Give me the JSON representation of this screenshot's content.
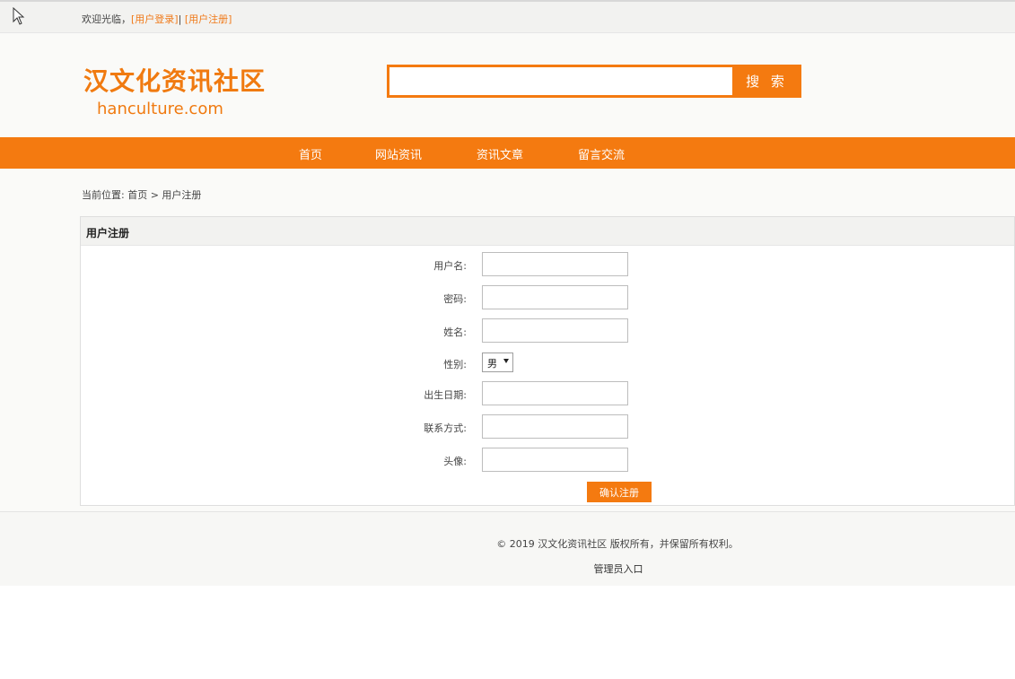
{
  "topbar": {
    "welcome": "欢迎光临，",
    "login_link": "[用户登录]",
    "separator": "|",
    "register_link": "[用户注册]"
  },
  "header": {
    "site_title": "汉文化资讯社区",
    "site_domain": "hanculture.com",
    "search": {
      "value": "",
      "placeholder": "",
      "button_label": "搜 索"
    }
  },
  "nav": {
    "items": [
      {
        "label": "首页"
      },
      {
        "label": "网站资讯"
      },
      {
        "label": "资讯文章"
      },
      {
        "label": "留言交流"
      }
    ]
  },
  "breadcrumb": "当前位置: 首页 > 用户注册",
  "form": {
    "title": "用户注册",
    "fields": {
      "username": {
        "label": "用户名:",
        "value": ""
      },
      "password": {
        "label": "密码:",
        "value": ""
      },
      "name": {
        "label": "姓名:",
        "value": ""
      },
      "gender": {
        "label": "性别:",
        "value": "男"
      },
      "birthdate": {
        "label": "出生日期:",
        "value": ""
      },
      "contact": {
        "label": "联系方式:",
        "value": ""
      },
      "avatar": {
        "label": "头像:",
        "value": ""
      }
    },
    "submit_label": "确认注册"
  },
  "footer": {
    "copyright": "© 2019 汉文化资讯社区 版权所有，并保留所有权利。",
    "admin_link": "管理员入口"
  },
  "colors": {
    "accent": "#f47a10",
    "link": "#f07a1a"
  }
}
